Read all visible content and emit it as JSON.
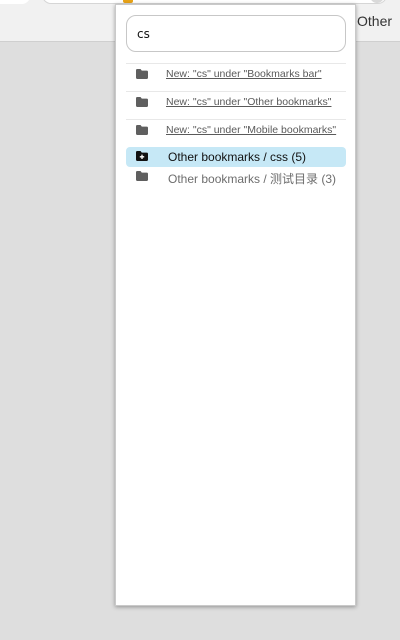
{
  "browser": {
    "bookmarks_bar_item": "Other"
  },
  "popup": {
    "search": {
      "value": "cs"
    },
    "new_options": [
      {
        "label": "New: \"cs\" under \"Bookmarks bar\"",
        "icon": "folder-icon"
      },
      {
        "label": "New: \"cs\" under \"Other bookmarks\"",
        "icon": "folder-icon"
      },
      {
        "label": "New: \"cs\" under \"Mobile bookmarks\"",
        "icon": "folder-icon"
      }
    ],
    "folders": [
      {
        "label": "Other bookmarks / css (5)",
        "icon": "folder-add-icon",
        "selected": true
      },
      {
        "label": "Other bookmarks / 测试目录 (3)",
        "icon": "folder-icon",
        "selected": false
      }
    ]
  },
  "colors": {
    "selected_row": "#c6e8f6",
    "folder_icon": "#5f5f5f",
    "selected_folder_icon": "#111111"
  }
}
